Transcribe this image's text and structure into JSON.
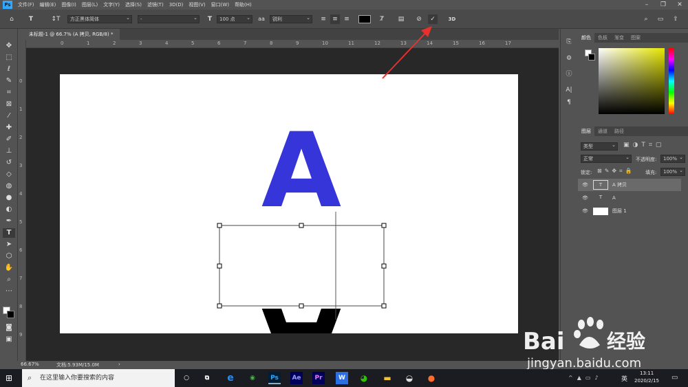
{
  "menubar": {
    "logo": "Ps",
    "items": [
      "文件(F)",
      "编辑(E)",
      "图像(I)",
      "图层(L)",
      "文字(Y)",
      "选择(S)",
      "滤镜(T)",
      "3D(D)",
      "视图(V)",
      "窗口(W)",
      "帮助(H)"
    ]
  },
  "options": {
    "font_family": "方正黑体简体",
    "font_style": "-",
    "font_size": "100 点",
    "aa_label": "aa",
    "antialias": "锐利",
    "commit_icon": "✓",
    "cancel_icon": "⊘",
    "three_d": "3D",
    "color_swatch": "#000000"
  },
  "document": {
    "tab_title": "未标题-1 @ 66.7% (A 拷贝, RGB/8) *",
    "top_letter": "A",
    "top_letter_color": "#3535d9",
    "bottom_letter": "A",
    "bottom_letter_color": "#000000"
  },
  "ruler": {
    "h": [
      "0",
      "1",
      "2",
      "3",
      "4",
      "5",
      "6",
      "7",
      "8",
      "9",
      "10",
      "11",
      "12",
      "13",
      "14",
      "15",
      "16",
      "17"
    ],
    "v": [
      "0",
      "1",
      "2",
      "3",
      "4",
      "5",
      "6",
      "7",
      "8",
      "9"
    ]
  },
  "status": {
    "zoom": "66.67%",
    "doc": "文档:5.93M/15.0M"
  },
  "color_panel": {
    "tabs": [
      "颜色",
      "色板",
      "渐变",
      "图案"
    ],
    "hue": "#e6e600"
  },
  "layers_panel": {
    "tabs": [
      "图层",
      "通道",
      "路径"
    ],
    "filter": "类型",
    "blend": "正常",
    "opacity_label": "不透明度:",
    "opacity": "100%",
    "lock_label": "锁定:",
    "fill_label": "填充:",
    "fill": "100%",
    "layers": [
      {
        "name": "A 拷贝",
        "type": "text",
        "selected": true
      },
      {
        "name": "A",
        "type": "text",
        "selected": false
      },
      {
        "name": "图层 1",
        "type": "pixel",
        "selected": false
      }
    ]
  },
  "taskbar": {
    "search_placeholder": "在这里输入你要搜索的内容",
    "ime": "英",
    "time": "13:11",
    "date": "2020/2/15",
    "apps": [
      "e",
      "Ps",
      "Ae",
      "Pr",
      "W"
    ]
  },
  "watermark": {
    "brand": "Bai",
    "brand_cn": "经验",
    "url": "jingyan.baidu.com"
  }
}
